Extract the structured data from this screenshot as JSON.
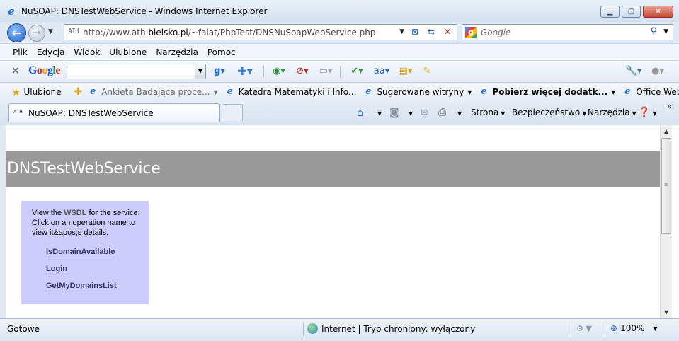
{
  "window": {
    "title": "NuSOAP: DNSTestWebService - Windows Internet Explorer",
    "minimize": "▁",
    "maximize": "▢",
    "close": "✕"
  },
  "address": {
    "url_prefix": "http://www.ath.",
    "url_domain": "bielsko.pl",
    "url_path": "/~falat/PhpTest/DNSNuSoapWebService.php",
    "favicon": "ATH"
  },
  "search": {
    "placeholder": "Google"
  },
  "menu": {
    "items": [
      "Plik",
      "Edycja",
      "Widok",
      "Ulubione",
      "Narzędzia",
      "Pomoc"
    ]
  },
  "google_toolbar": {
    "logo": [
      "G",
      "o",
      "o",
      "g",
      "l",
      "e"
    ]
  },
  "favorites": {
    "label": "Ulubione",
    "links": [
      {
        "label": "Ankieta Badająca proce...",
        "style": "dim",
        "has_dropdown": true
      },
      {
        "label": "Katedra Matematyki i Info...",
        "style": "normal",
        "has_dropdown": false
      },
      {
        "label": "Sugerowane witryny",
        "style": "normal",
        "has_dropdown": true
      },
      {
        "label": "Pobierz więcej dodatk...",
        "style": "bold",
        "has_dropdown": true
      },
      {
        "label": "Office Web Apps",
        "style": "normal",
        "has_dropdown": false
      }
    ]
  },
  "tabs": {
    "active_label": "NuSOAP: DNSTestWebService"
  },
  "commandbar": {
    "page": "Strona",
    "safety": "Bezpieczeństwo",
    "tools": "Narzędzia",
    "more": "»"
  },
  "page": {
    "banner_title": "DNSTestWebService",
    "intro_before": "View the ",
    "wsdl_link": "WSDL",
    "intro_after": " for the service. Click on an operation name to view it&apos;s details.",
    "operations": [
      "IsDomainAvailable",
      "Login",
      "GetMyDomainsList"
    ]
  },
  "status": {
    "text": "Gotowe",
    "zone": "Internet | Tryb chroniony: wyłączony",
    "zoom": "100%"
  },
  "colors": {
    "banner_bg": "#999999",
    "opbox_bg": "#ccccff",
    "op_link": "#1a1aa6"
  }
}
